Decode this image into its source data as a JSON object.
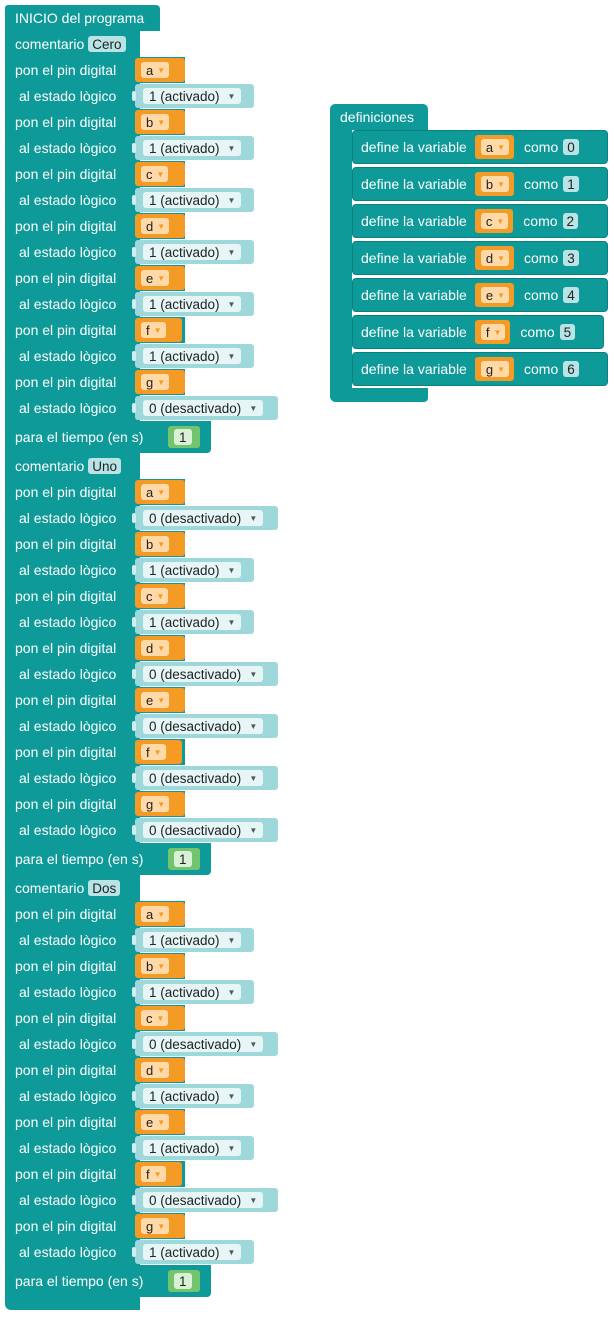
{
  "start_label": "INICIO del programa",
  "comment_label": "comentario",
  "pin_label": "pon el pin digital",
  "state_label": "al estado lògico",
  "wait_label": "para el tiempo  (en s)",
  "sections": [
    {
      "comment": "Cero",
      "wait": "1",
      "pins": [
        {
          "var": "a",
          "state": "1 (activado)"
        },
        {
          "var": "b",
          "state": "1 (activado)"
        },
        {
          "var": "c",
          "state": "1 (activado)"
        },
        {
          "var": "d",
          "state": "1 (activado)"
        },
        {
          "var": "e",
          "state": "1 (activado)"
        },
        {
          "var": "f",
          "state": "1 (activado)"
        },
        {
          "var": "g",
          "state": "0 (desactivado)"
        }
      ]
    },
    {
      "comment": "Uno",
      "wait": "1",
      "pins": [
        {
          "var": "a",
          "state": "0 (desactivado)"
        },
        {
          "var": "b",
          "state": "1 (activado)"
        },
        {
          "var": "c",
          "state": "1 (activado)"
        },
        {
          "var": "d",
          "state": "0 (desactivado)"
        },
        {
          "var": "e",
          "state": "0 (desactivado)"
        },
        {
          "var": "f",
          "state": "0 (desactivado)"
        },
        {
          "var": "g",
          "state": "0 (desactivado)"
        }
      ]
    },
    {
      "comment": "Dos",
      "wait": "1",
      "pins": [
        {
          "var": "a",
          "state": "1 (activado)"
        },
        {
          "var": "b",
          "state": "1 (activado)"
        },
        {
          "var": "c",
          "state": "0 (desactivado)"
        },
        {
          "var": "d",
          "state": "1 (activado)"
        },
        {
          "var": "e",
          "state": "1 (activado)"
        },
        {
          "var": "f",
          "state": "0 (desactivado)"
        },
        {
          "var": "g",
          "state": "1 (activado)"
        }
      ]
    }
  ],
  "definitions": {
    "title": "definiciones",
    "define_label": "define la variable",
    "as_label": "como",
    "items": [
      {
        "var": "a",
        "value": "0"
      },
      {
        "var": "b",
        "value": "1"
      },
      {
        "var": "c",
        "value": "2"
      },
      {
        "var": "d",
        "value": "3"
      },
      {
        "var": "e",
        "value": "4"
      },
      {
        "var": "f",
        "value": "5"
      },
      {
        "var": "g",
        "value": "6"
      }
    ]
  },
  "colors": {
    "block": "#0f9a9a",
    "variable": "#f39b24",
    "state_input": "#9fd8db",
    "number_input": "#74c36e"
  },
  "icons": {
    "dropdown": "triangle-down-icon"
  }
}
